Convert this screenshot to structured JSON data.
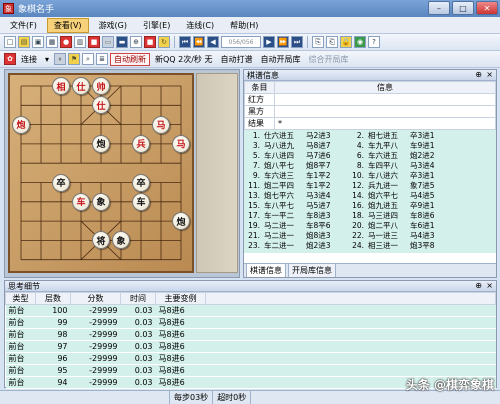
{
  "window": {
    "title": "象棋名手",
    "minimize": "–",
    "maximize": "□",
    "close": "✕"
  },
  "menu": [
    "文件(F)",
    "查看(V)",
    "游戏(G)",
    "引擎(E)",
    "连线(C)",
    "帮助(H)"
  ],
  "toolbar2": {
    "counter": "056/056"
  },
  "toolbar3": {
    "connect_label": "连接",
    "auto_refresh": "自动刷新",
    "speed_text": "新QQ 2次/秒 无",
    "auto_hit": "自动打谱",
    "auto_open": "自动开局库",
    "composite_open": "综合开局库"
  },
  "board": {
    "pieces": [
      {
        "ch": "相",
        "side": "red",
        "col": 2,
        "row": 0
      },
      {
        "ch": "仕",
        "side": "red",
        "col": 3,
        "row": 0
      },
      {
        "ch": "帅",
        "side": "red",
        "col": 4,
        "row": 0
      },
      {
        "ch": "仕",
        "side": "red",
        "col": 4,
        "row": 1
      },
      {
        "ch": "炮",
        "side": "red",
        "col": 0,
        "row": 2
      },
      {
        "ch": "马",
        "side": "red",
        "col": 7,
        "row": 2
      },
      {
        "ch": "炮",
        "side": "black",
        "col": 4,
        "row": 3
      },
      {
        "ch": "兵",
        "side": "red",
        "col": 6,
        "row": 3
      },
      {
        "ch": "马",
        "side": "red",
        "col": 8,
        "row": 3
      },
      {
        "ch": "卒",
        "side": "black",
        "col": 2,
        "row": 5
      },
      {
        "ch": "卒",
        "side": "black",
        "col": 6,
        "row": 5
      },
      {
        "ch": "车",
        "side": "red",
        "col": 3,
        "row": 6
      },
      {
        "ch": "象",
        "side": "black",
        "col": 4,
        "row": 6
      },
      {
        "ch": "车",
        "side": "black",
        "col": 6,
        "row": 6
      },
      {
        "ch": "炮",
        "side": "black",
        "col": 8,
        "row": 7
      },
      {
        "ch": "将",
        "side": "black",
        "col": 4,
        "row": 8
      },
      {
        "ch": "象",
        "side": "black",
        "col": 5,
        "row": 8
      }
    ]
  },
  "info": {
    "header": "棋谱信息",
    "pin": "⊕",
    "close": "×",
    "col_item": "条目",
    "col_info": "信息",
    "rows": [
      {
        "item": "红方",
        "info": ""
      },
      {
        "item": "黑方",
        "info": ""
      },
      {
        "item": "结果",
        "info": "*"
      }
    ],
    "moves": [
      [
        "1.",
        "仕六进五",
        "马2进3",
        "2.",
        "相七进五",
        "卒3进1"
      ],
      [
        "3.",
        "马八进九",
        "马8进7",
        "4.",
        "车九平八",
        "车9进1"
      ],
      [
        "5.",
        "车八进四",
        "马7进6",
        "6.",
        "车六进五",
        "炮2进2"
      ],
      [
        "7.",
        "炮八平七",
        "炮8平7",
        "8.",
        "车四平八",
        "马3进4"
      ],
      [
        "9.",
        "车六进三",
        "车1平2",
        "10.",
        "车八进六",
        "卒3进1"
      ],
      [
        "11.",
        "炮二平四",
        "车1平2",
        "12.",
        "兵九进一",
        "象7进5"
      ],
      [
        "13.",
        "炮七平六",
        "马3进4",
        "14.",
        "炮六平七",
        "马4进5"
      ],
      [
        "15.",
        "车八平七",
        "马5进7",
        "16.",
        "炮九进五",
        "卒9进1"
      ],
      [
        "17.",
        "车一平二",
        "车8进3",
        "18.",
        "马三进四",
        "车8进6"
      ],
      [
        "19.",
        "马二进一",
        "车8平6",
        "20.",
        "炮二平八",
        "车6进1"
      ],
      [
        "21.",
        "马二进一",
        "炮8进3",
        "22.",
        "马一进三",
        "马4进3"
      ],
      [
        "23.",
        "车二进一",
        "炮2进3",
        "24.",
        "相三进一",
        "炮3平8"
      ]
    ],
    "tabs": [
      "棋谱信息",
      "开局库信息"
    ]
  },
  "think": {
    "header": "思考细节",
    "pin": "⊕",
    "close": "×",
    "columns": [
      "类型",
      "层数",
      "分数",
      "时间",
      "主要变例"
    ],
    "rows": [
      [
        "前台",
        "100",
        "-29999",
        "0.03",
        "马8进6"
      ],
      [
        "前台",
        "99",
        "-29999",
        "0.03",
        "马8进6"
      ],
      [
        "前台",
        "98",
        "-29999",
        "0.03",
        "马8进6"
      ],
      [
        "前台",
        "97",
        "-29999",
        "0.03",
        "马8进6"
      ],
      [
        "前台",
        "96",
        "-29999",
        "0.03",
        "马8进6"
      ],
      [
        "前台",
        "95",
        "-29999",
        "0.03",
        "马8进6"
      ],
      [
        "前台",
        "94",
        "-29999",
        "0.03",
        "马8进6"
      ]
    ]
  },
  "status": {
    "left": "",
    "per_step": "每步03秒",
    "timeout": "超时0秒"
  },
  "watermark": "头条 @棋弈象棋"
}
